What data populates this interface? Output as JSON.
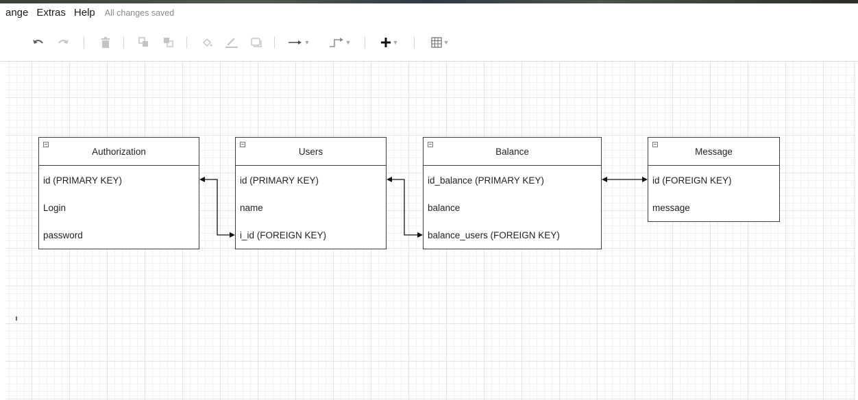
{
  "menubar": {
    "items": [
      "ange",
      "Extras",
      "Help"
    ],
    "status": "All changes saved"
  },
  "toolbar": {
    "tools": [
      "undo-icon",
      "redo-icon",
      "delete-icon",
      "to-front-icon",
      "to-back-icon",
      "fill-color-icon",
      "line-color-icon",
      "shadow-icon",
      "connection-icon",
      "waypoints-icon",
      "insert-icon",
      "table-icon"
    ]
  },
  "entities": [
    {
      "id": "authorization",
      "title": "Authorization",
      "rows": [
        "id (PRIMARY KEY)",
        "Login",
        "password"
      ]
    },
    {
      "id": "users",
      "title": "Users",
      "rows": [
        "id (PRIMARY KEY)",
        "name",
        "i_id  (FOREIGN KEY)"
      ]
    },
    {
      "id": "balance",
      "title": "Balance",
      "rows": [
        "id_balance (PRIMARY KEY)",
        "balance",
        "balance_users (FOREIGN KEY)"
      ]
    },
    {
      "id": "message",
      "title": "Message",
      "rows": [
        "id (FOREIGN KEY)",
        "message"
      ]
    }
  ],
  "colors": {
    "grid_major": "#e3e3e3",
    "grid_minor": "#f1f1f1",
    "entity_border": "#3c3c3c",
    "connector": "#111111"
  }
}
